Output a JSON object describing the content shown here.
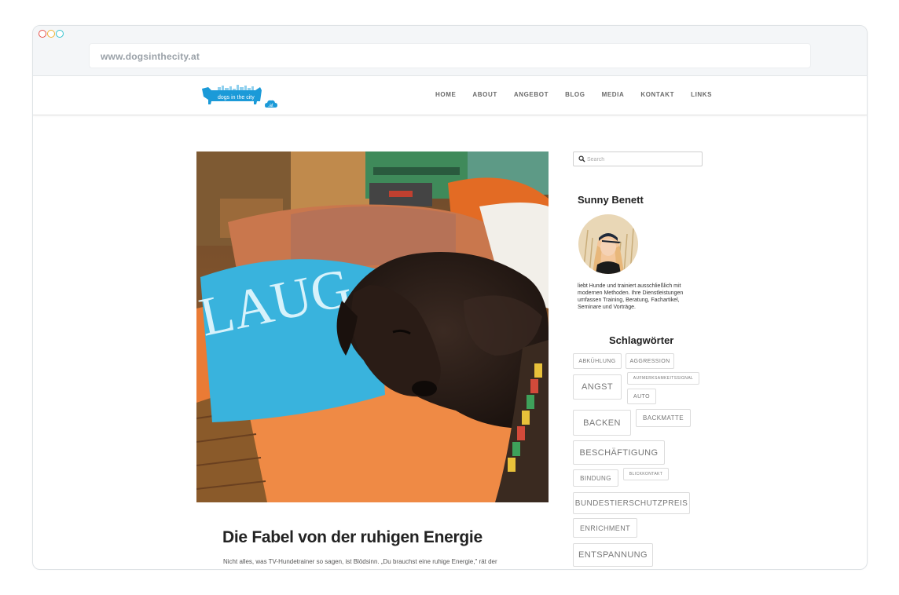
{
  "browser": {
    "url": "www.dogsinthecity.at"
  },
  "site": {
    "logo_text": "dogs in the city",
    "logo_suffix": ".at",
    "nav": [
      "HOME",
      "ABOUT",
      "ANGEBOT",
      "BLOG",
      "MEDIA",
      "KONTAKT",
      "LINKS"
    ]
  },
  "post": {
    "image_text": "LAUG",
    "title": "Die Fabel von der ruhigen Energie",
    "excerpt": "Nicht alles, was TV-Hundetrainer so sagen, ist Blödsinn. „Du brauchst eine ruhige Energie,\" rät der"
  },
  "sidebar": {
    "search_placeholder": "Search",
    "author_name": "Sunny Benett",
    "author_bio": "liebt Hunde und trainiert ausschließlich mit modernen Methoden. Ihre Dienstleistungen umfassen Training, Beratung, Fachartikel, Seminare und Vorträge.",
    "tags_title": "Schlagwörter",
    "tags": [
      "ABKÜHLUNG",
      "AGGRESSION",
      "ANGST",
      "AUFMERKSAMKEITSSIGNAL",
      "AUTO",
      "BACKEN",
      "BACKMATTE",
      "BESCHÄFTIGUNG",
      "BINDUNG",
      "BLICKKONTAKT",
      "BUNDESTIERSCHUTZPREIS",
      "ENRICHMENT",
      "ENTSPANNUNG"
    ]
  }
}
